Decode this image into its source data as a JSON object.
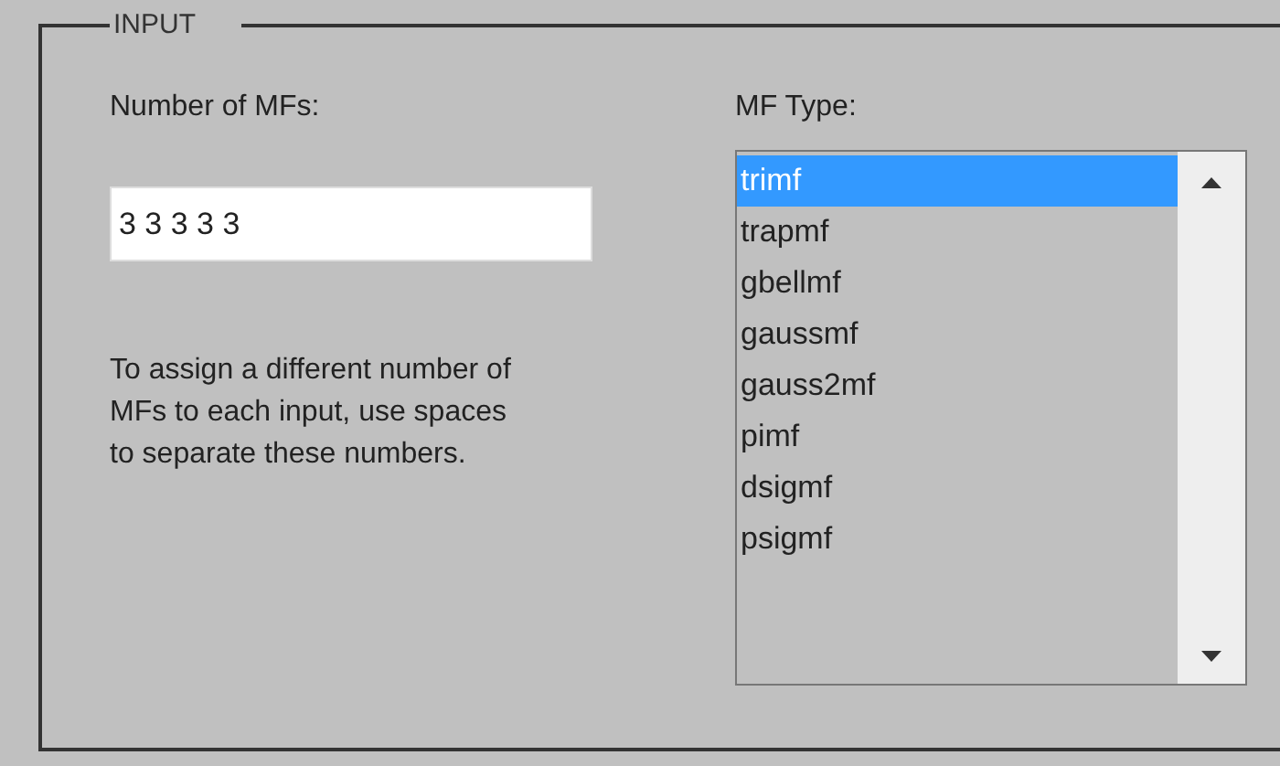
{
  "group": {
    "title": "INPUT"
  },
  "count": {
    "label": "Number of MFs:",
    "value": "3 3 3 3 3",
    "help": "To assign a different number of MFs to each input, use spaces to separate these numbers."
  },
  "type": {
    "label": "MF Type:",
    "items": [
      {
        "label": "trimf",
        "selected": true
      },
      {
        "label": "trapmf",
        "selected": false
      },
      {
        "label": "gbellmf",
        "selected": false
      },
      {
        "label": "gaussmf",
        "selected": false
      },
      {
        "label": "gauss2mf",
        "selected": false
      },
      {
        "label": "pimf",
        "selected": false
      },
      {
        "label": "dsigmf",
        "selected": false
      },
      {
        "label": "psigmf",
        "selected": false
      }
    ]
  }
}
